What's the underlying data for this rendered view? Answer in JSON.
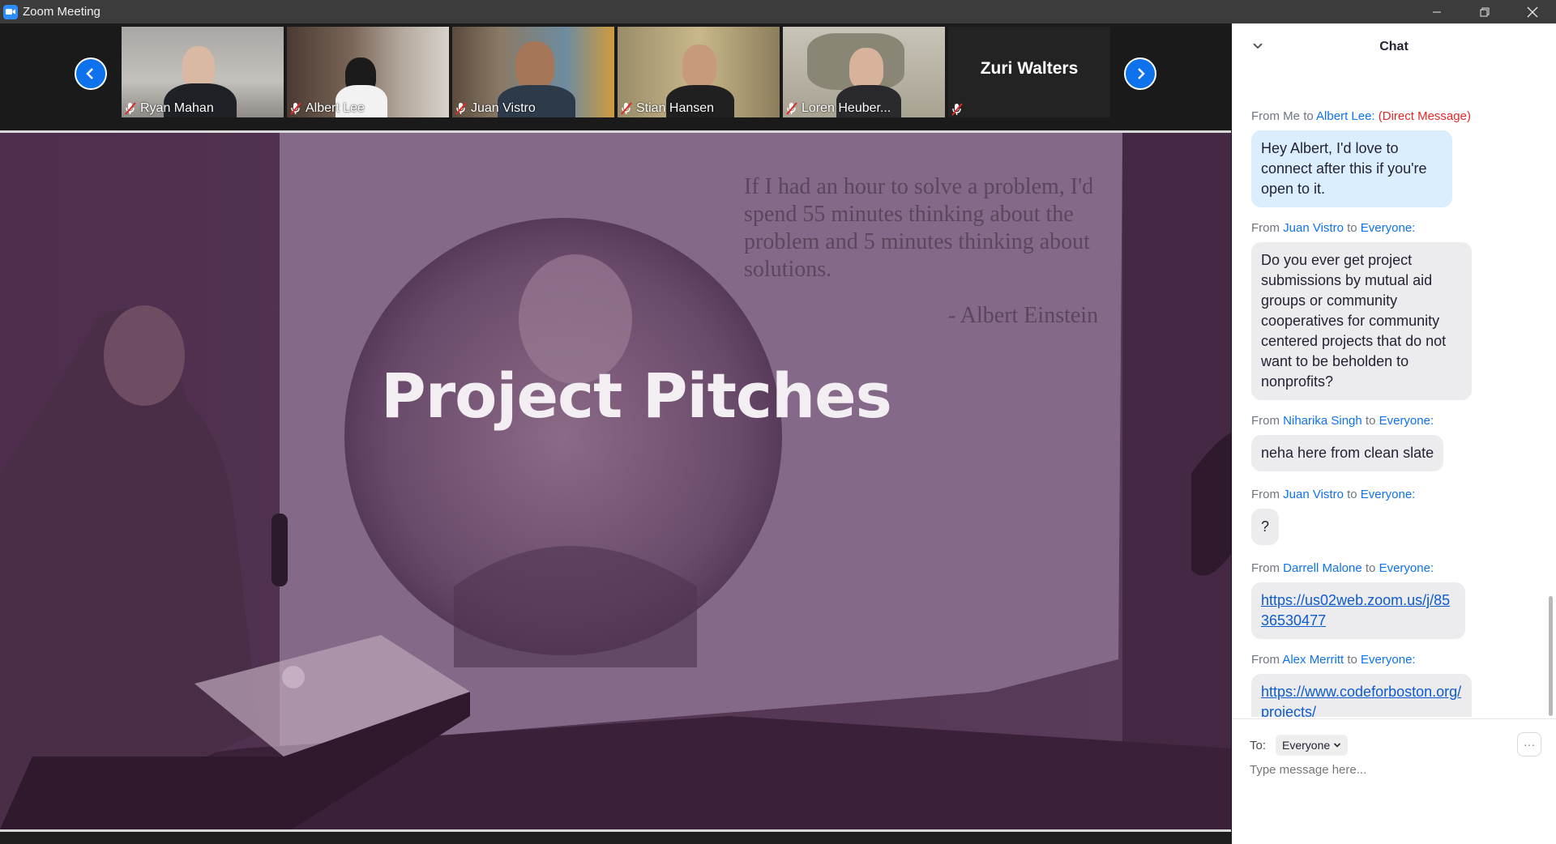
{
  "window": {
    "title": "Zoom Meeting"
  },
  "gallery": {
    "participants": [
      {
        "name": "Ryan Mahan",
        "muted": true
      },
      {
        "name": "Albert Lee",
        "muted": true
      },
      {
        "name": "Juan Vistro",
        "muted": true
      },
      {
        "name": "Stian Hansen",
        "muted": true
      },
      {
        "name": "Loren Heuber...",
        "muted": true
      },
      {
        "name": "Zuri Walters",
        "muted": true,
        "video": false
      }
    ]
  },
  "share": {
    "slide_title": "Project Pitches",
    "quote": "If I had an hour to solve a problem, I'd spend 55 minutes thinking about the problem and 5 minutes thinking about solutions.",
    "quote_author": "- Albert Einstein"
  },
  "chat": {
    "title": "Chat",
    "messages": [
      {
        "from_label": "From",
        "sender": "Me",
        "to_label": "to",
        "recipient": "Albert Lee:",
        "tag": "(Direct Message)",
        "text": "Hey Albert, I'd love to connect after this if you're open to it."
      },
      {
        "from_label": "From",
        "sender": "Juan Vistro",
        "to_label": "to",
        "recipient": "Everyone:",
        "text": "Do you ever get project submissions by mutual aid groups or community cooperatives for community centered projects that do not want to be beholden to nonprofits?"
      },
      {
        "from_label": "From",
        "sender": "Niharika Singh",
        "to_label": "to",
        "recipient": "Everyone:",
        "text": "neha here from clean slate"
      },
      {
        "from_label": "From",
        "sender": "Juan Vistro",
        "to_label": "to",
        "recipient": "Everyone:",
        "text": "?"
      },
      {
        "from_label": "From",
        "sender": "Darrell Malone",
        "to_label": "to",
        "recipient": "Everyone:",
        "link": "https://us02web.zoom.us/j/8536530477"
      },
      {
        "from_label": "From",
        "sender": "Alex Merritt",
        "to_label": "to",
        "recipient": "Everyone:",
        "link": "https://www.codeforboston.org/projects/"
      }
    ],
    "to_label": "To:",
    "to_value": "Everyone",
    "input_placeholder": "Type message here...",
    "more_label": "···"
  },
  "colors": {
    "accent": "#0e72ed",
    "direct_message": "#e02828",
    "muted": "#e02828"
  }
}
